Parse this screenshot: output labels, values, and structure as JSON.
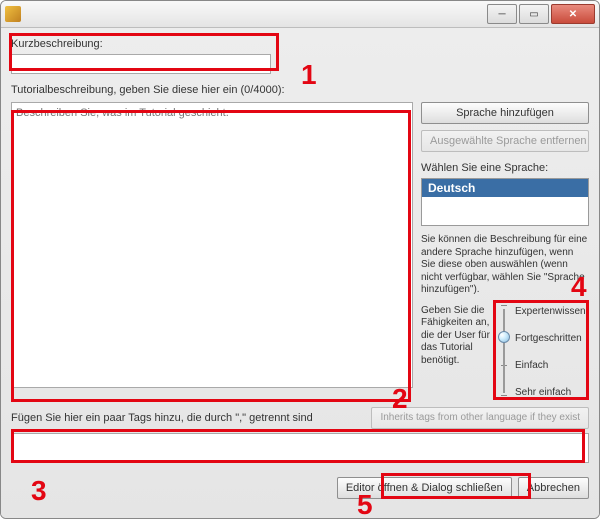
{
  "window": {
    "title": ""
  },
  "labels": {
    "short_desc": "Kurzbeschreibung:",
    "tutorial_desc": "Tutorialbeschreibung, geben Sie diese hier ein (0/4000):",
    "desc_placeholder": "Beschreiben Sie, was im Tutorial geschieht.",
    "choose_lang": "Wählen Sie eine Sprache:",
    "lang_note": "Sie können die Beschreibung für eine andere Sprache hinzufügen, wenn Sie diese oben auswählen (wenn nicht verfügbar, wählen Sie \"Sprache hinzufügen\").",
    "skill_note": "Geben Sie die Fähigkeiten an, die der User für das Tutorial benötigt.",
    "tags": "Fügen Sie hier ein paar Tags hinzu, die durch \",\" getrennt sind"
  },
  "buttons": {
    "add_lang": "Sprache hinzufügen",
    "remove_lang": "Ausgewählte Sprache entfernen",
    "inherit_tags": "Inherits tags from other language if they exist",
    "open_editor": "Editor öffnen & Dialog schließen",
    "cancel": "Abbrechen"
  },
  "languages": {
    "items": [
      "Deutsch"
    ],
    "selected": "Deutsch"
  },
  "skill": {
    "levels": [
      "Expertenwissen",
      "Fortgeschritten",
      "Einfach",
      "Sehr einfach"
    ],
    "selected_index": 1
  },
  "inputs": {
    "short_desc": "",
    "tags": ""
  },
  "annotations": {
    "1": "1",
    "2": "2",
    "3": "3",
    "4": "4",
    "5": "5"
  }
}
